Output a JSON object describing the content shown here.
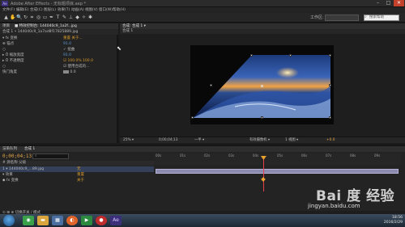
{
  "window": {
    "title": "Adobe After Effects - 无标题项目.aep *",
    "app_icon": "Ae",
    "minimize": "–",
    "maximize": "□",
    "close": "✕"
  },
  "menu": [
    "文件(F)",
    "编辑(E)",
    "合成(C)",
    "图层(L)",
    "效果(T)",
    "动画(A)",
    "视图(V)",
    "窗口(W)",
    "帮助(H)"
  ],
  "toolbar": {
    "tools": [
      "selection-tool-icon",
      "hand-tool-icon",
      "zoom-tool-icon",
      "rotate-tool-icon",
      "camera-tool-icon",
      "pan-behind-tool-icon",
      "rectangle-tool-icon",
      "pen-tool-icon",
      "type-tool-icon",
      "brush-tool-icon",
      "clone-stamp-tool-icon",
      "eraser-tool-icon",
      "roto-brush-tool-icon",
      "puppet-tool-icon"
    ],
    "tool_glyphs": [
      "▲",
      "✋",
      "🔍",
      "↻",
      "⌗",
      "◎",
      "▭",
      "✒",
      "T",
      "✎",
      "⊥",
      "◆",
      "✧",
      "✱"
    ],
    "workspace_label": "工作区:",
    "workspace_value": "",
    "search_placeholder": "搜索帮助"
  },
  "left_panel": {
    "tab1": "项目",
    "tab2": "■ 特效控制台: 144040c9_1a2f...jpg",
    "subtitle": "合成 1 • 144040c9_1a7ad8f17825889.jpg",
    "rows": [
      {
        "name": "▾ fx  变换",
        "value": "重置    关于...",
        "style": "orange"
      },
      {
        "name": "      ⊕ 锚点",
        "value": "91.0",
        "style": "blue"
      },
      {
        "name": "      ○",
        "value": "✓ 扭曲",
        "style": ""
      },
      {
        "name": "   ▸ Ö 缩放宽度",
        "value": "91.0",
        "style": "blue"
      },
      {
        "name": "   ▸ Ö 不透明度",
        "value": "☑ 100.0%   100.0",
        "style": "orange"
      },
      {
        "name": "      ○",
        "value": "☑ 使用合成的...",
        "style": ""
      },
      {
        "name": "   快门角度",
        "value": "0.0",
        "style": ""
      }
    ]
  },
  "comp_panel": {
    "tab": "合成: 合成 1 ▾",
    "sub": "合成 1",
    "footer": {
      "zoom": "25% ▾",
      "timecode": "0;00;04;13",
      "resolution": "一半 ▾",
      "camera": "有效摄像机 ▾",
      "views": "1 视图 ▾",
      "exposure": "+0.0"
    }
  },
  "timeline": {
    "tab1": "渲染队列",
    "tab2": "合成 1",
    "timecode": "0;00;04;13",
    "search_placeholder": "⌕",
    "col_headers": "#    源名称                  父级",
    "layers": [
      {
        "row": "1   ▾  144040c9_...89.jpg",
        "parent": "无"
      },
      {
        "row": "      ▾ 效果",
        "parent": "重置"
      },
      {
        "row": "        ◆ fx  变换",
        "parent": "关于"
      }
    ],
    "ruler_ticks": [
      "00s",
      "01s",
      "02s",
      "03s",
      "04s",
      "05s",
      "06s",
      "07s",
      "08s",
      "09s"
    ],
    "playhead_time": 4.43,
    "duration": 10,
    "bottom": "⊙ ⊞ ⊕           切换开关 / 模式"
  },
  "taskbar": {
    "apps": [
      "start",
      "green-app",
      "folder",
      "media",
      "firefox",
      "player",
      "record",
      "after-effects"
    ],
    "time": "18:56",
    "date": "2016/2/29"
  },
  "watermark": {
    "brand": "Bai 度 经验",
    "url": "jingyan.baidu.com"
  },
  "colors": {
    "timecode": "#e2a74b",
    "playhead": "#e5404a",
    "layer_bar": "#8d8ab0",
    "accent_orange": "#d99a2b",
    "accent_blue": "#5e9bd6"
  }
}
